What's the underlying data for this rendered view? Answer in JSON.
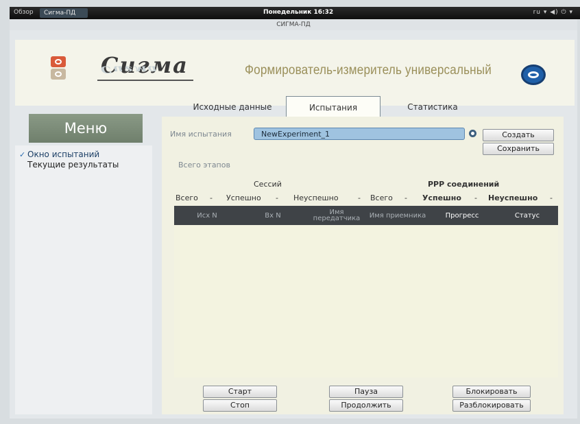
{
  "system_bar": {
    "left_item_1": "Обзор",
    "left_item_2": "Сигма-ПД",
    "clock": "Понедельник 16:32",
    "status": "ru ▾   ◀) ⏻ ▾"
  },
  "window": {
    "title": "СИГМА-ПД"
  },
  "header": {
    "logo_text": "Сигма",
    "logo_text_reflection": "Сигма",
    "product_title": "Формирователь-измеритель универсальный"
  },
  "sidebar": {
    "title": "Меню",
    "items": [
      {
        "label": "Окно испытаний",
        "active": true,
        "check": "✓"
      },
      {
        "label": "Текущие результаты",
        "active": false
      }
    ]
  },
  "tabs": [
    {
      "label": "Исходные данные",
      "selected": false
    },
    {
      "label": "Испытания",
      "selected": true
    },
    {
      "label": "Статистика",
      "selected": false
    }
  ],
  "experiment": {
    "name_label": "Имя испытания",
    "name_value": "NewExperiment_1",
    "create_label": "Создать",
    "save_label": "Сохранить",
    "stages_label": "Всего этапов"
  },
  "summary": {
    "sessions_title": "Сессий",
    "ppp_title": "PPP соединений",
    "sessions": {
      "total_label": "Всего",
      "total_value": "-",
      "success_label": "Успешно",
      "success_value": "-",
      "fail_label": "Неуспешно",
      "fail_value": "-"
    },
    "ppp": {
      "total_label": "Всего",
      "total_value": "-",
      "success_label": "Успешно",
      "success_value": "-",
      "fail_label": "Неуспешно",
      "fail_value": "-"
    }
  },
  "table": {
    "columns": [
      "Исх N",
      "Вх N",
      "Имя передатчика",
      "Имя приемника",
      "Прогресс",
      "Статус"
    ],
    "rows": []
  },
  "controls": {
    "start": "Старт",
    "stop": "Стоп",
    "pause": "Пауза",
    "resume": "Продолжить",
    "block": "Блокировать",
    "unblock": "Разблокировать"
  },
  "colors": {
    "menu_title_bg": "#7f8f7b",
    "input_bg": "#9fc3e0",
    "table_header_bg": "#3f4347",
    "product_title": "#9a8f5a",
    "brand_badge": "#1f5fa8"
  }
}
